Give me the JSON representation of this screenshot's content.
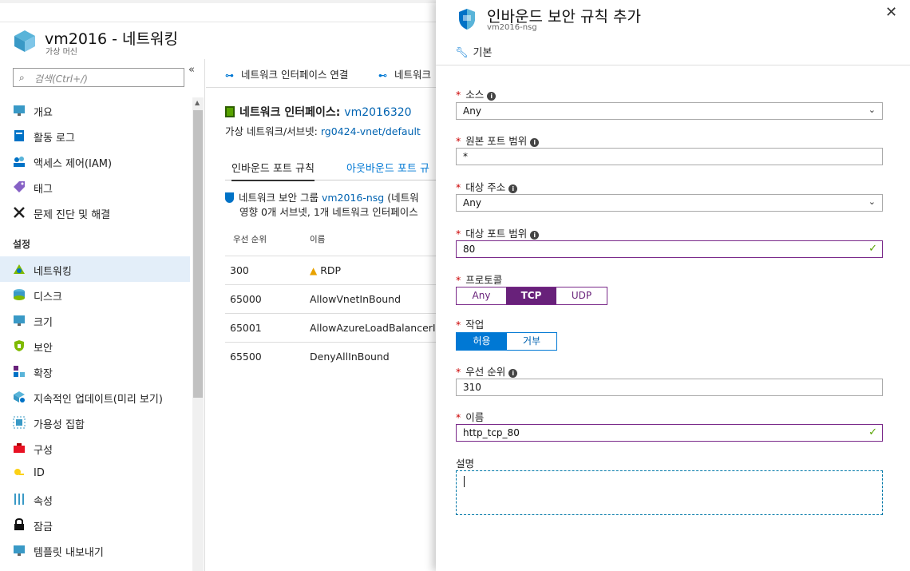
{
  "blade": {
    "title": "vm2016 - 네트워킹",
    "subtitle": "가상 머신"
  },
  "sidebar": {
    "search_placeholder": "검색(Ctrl+/)",
    "collapse": "«",
    "section_settings": "설정",
    "items": [
      {
        "label": "개요",
        "icon": "overview-icon"
      },
      {
        "label": "활동 로그",
        "icon": "activity-log-icon"
      },
      {
        "label": "액세스 제어(IAM)",
        "icon": "iam-icon"
      },
      {
        "label": "태그",
        "icon": "tag-icon"
      },
      {
        "label": "문제 진단 및 해결",
        "icon": "wrench-icon"
      },
      {
        "label": "네트워킹",
        "icon": "networking-icon"
      },
      {
        "label": "디스크",
        "icon": "disk-icon"
      },
      {
        "label": "크기",
        "icon": "size-icon"
      },
      {
        "label": "보안",
        "icon": "security-icon"
      },
      {
        "label": "확장",
        "icon": "extensions-icon"
      },
      {
        "label": "지속적인 업데이트(미리 보기)",
        "icon": "continuous-update-icon"
      },
      {
        "label": "가용성 집합",
        "icon": "availability-set-icon"
      },
      {
        "label": "구성",
        "icon": "configuration-icon"
      },
      {
        "label": "ID",
        "icon": "identity-icon"
      },
      {
        "label": "속성",
        "icon": "properties-icon"
      },
      {
        "label": "잠금",
        "icon": "lock-icon"
      },
      {
        "label": "템플릿 내보내기",
        "icon": "export-template-icon"
      }
    ]
  },
  "main": {
    "toolbar": {
      "attach": "네트워크 인터페이스 연결",
      "detach": "네트워크"
    },
    "nic_label": "네트워크 인터페이스:",
    "nic_name": "vm2016320",
    "subnet_label": "가상 네트워크/서브넷:",
    "subnet_value": "rg0424-vnet/default",
    "tabs": [
      "인바운드 포트 규칙",
      "아웃바운드 포트 규"
    ],
    "nsg_label": "네트워크 보안 그룹",
    "nsg_name": "vm2016-nsg",
    "nsg_suffix": "(네트워",
    "nsg_impact": "영향 0개 서브넷, 1개 네트워크 인터페이스",
    "table": {
      "headers": [
        "우선 순위",
        "이름"
      ],
      "rows": [
        {
          "priority": "300",
          "name": "RDP",
          "warning": true
        },
        {
          "priority": "65000",
          "name": "AllowVnetInBound",
          "warning": false
        },
        {
          "priority": "65001",
          "name": "AllowAzureLoadBalancerInBound",
          "warning": false
        },
        {
          "priority": "65500",
          "name": "DenyAllInBound",
          "warning": false
        }
      ]
    }
  },
  "panel": {
    "title": "인바운드 보안 규칙 추가",
    "subtitle": "vm2016-nsg",
    "close": "✕",
    "mode": "기본",
    "fields": {
      "source": {
        "label": "소스",
        "value": "Any"
      },
      "source_port": {
        "label": "원본 포트 범위",
        "value": "*"
      },
      "destination": {
        "label": "대상 주소",
        "value": "Any"
      },
      "dest_port": {
        "label": "대상 포트 범위",
        "value": "80"
      },
      "protocol": {
        "label": "프로토콜",
        "options": [
          "Any",
          "TCP",
          "UDP"
        ],
        "selected": "TCP"
      },
      "action": {
        "label": "작업",
        "options": [
          "허용",
          "거부"
        ],
        "selected": "허용"
      },
      "priority": {
        "label": "우선 순위",
        "value": "310"
      },
      "name": {
        "label": "이름",
        "value": "http_tcp_80"
      },
      "description": {
        "label": "설명",
        "value": ""
      }
    }
  },
  "colors": {
    "accent": "#0078d4",
    "purple": "#68217a",
    "required": "#cc0000",
    "valid": "#57a300"
  }
}
